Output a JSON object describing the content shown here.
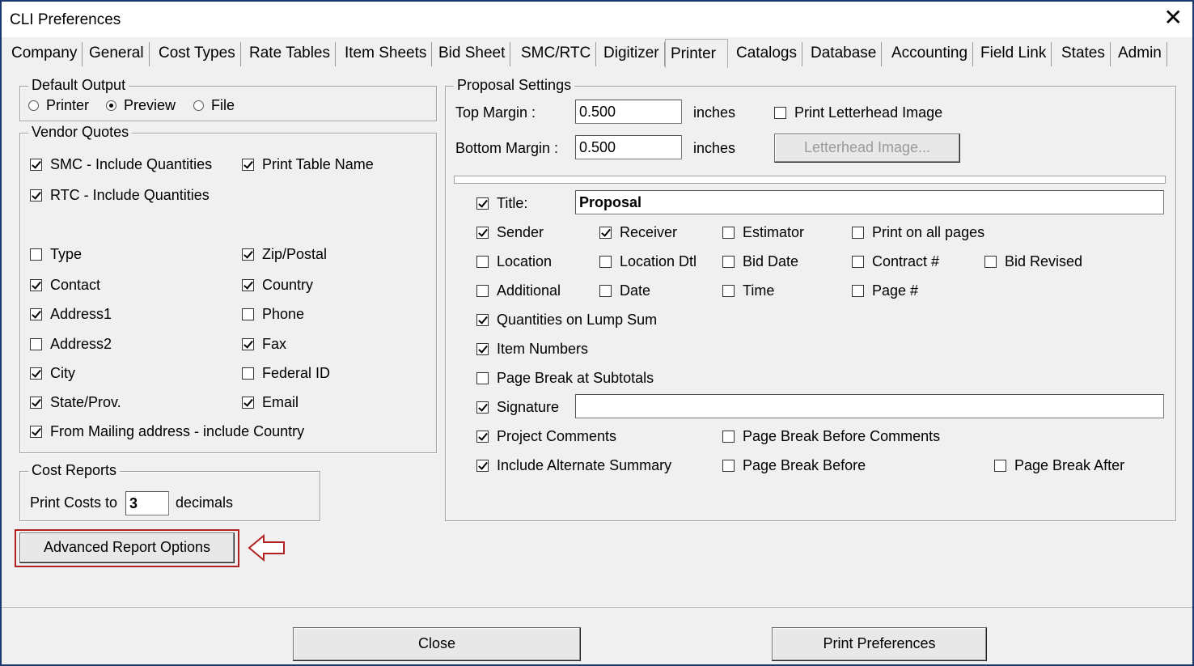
{
  "window": {
    "title": "CLI Preferences",
    "close_glyph": "✕"
  },
  "tabs": [
    {
      "label": "Company"
    },
    {
      "label": "General"
    },
    {
      "label": "Cost Types"
    },
    {
      "label": "Rate Tables"
    },
    {
      "label": "Item Sheets"
    },
    {
      "label": "Bid Sheet"
    },
    {
      "label": "SMC/RTC"
    },
    {
      "label": "Digitizer"
    },
    {
      "label": "Printer"
    },
    {
      "label": "Catalogs"
    },
    {
      "label": "Database"
    },
    {
      "label": "Accounting"
    },
    {
      "label": "Field Link"
    },
    {
      "label": "States"
    },
    {
      "label": "Admin"
    }
  ],
  "active_tab": "Printer",
  "default_output": {
    "legend": "Default Output",
    "options": [
      {
        "label": "Printer",
        "selected": false
      },
      {
        "label": "Preview",
        "selected": true
      },
      {
        "label": "File",
        "selected": false
      }
    ]
  },
  "vendor_quotes": {
    "legend": "Vendor Quotes",
    "smc_include_qty": {
      "label": "SMC - Include Quantities",
      "checked": true
    },
    "print_table_name": {
      "label": "Print Table Name",
      "checked": true
    },
    "rtc_include_qty": {
      "label": "RTC - Include Quantities",
      "checked": true
    },
    "type": {
      "label": "Type",
      "checked": false
    },
    "zip": {
      "label": "Zip/Postal",
      "checked": true
    },
    "contact": {
      "label": "Contact",
      "checked": true
    },
    "country": {
      "label": "Country",
      "checked": true
    },
    "address1": {
      "label": "Address1",
      "checked": true
    },
    "phone": {
      "label": "Phone",
      "checked": false
    },
    "address2": {
      "label": "Address2",
      "checked": false
    },
    "fax": {
      "label": "Fax",
      "checked": true
    },
    "city": {
      "label": "City",
      "checked": true
    },
    "federal_id": {
      "label": "Federal ID",
      "checked": false
    },
    "state": {
      "label": "State/Prov.",
      "checked": true
    },
    "email": {
      "label": "Email",
      "checked": true
    },
    "from_mailing": {
      "label": "From Mailing address - include Country",
      "checked": true
    }
  },
  "cost_reports": {
    "legend": "Cost Reports",
    "prefix": "Print Costs to",
    "decimals_value": "3",
    "suffix": "decimals"
  },
  "advanced_button": {
    "label": "Advanced Report Options"
  },
  "proposal": {
    "legend": "Proposal Settings",
    "top_margin_label": "Top Margin :",
    "top_margin_value": "0.500",
    "bottom_margin_label": "Bottom Margin :",
    "bottom_margin_value": "0.500",
    "unit": "inches",
    "print_letterhead": {
      "label": "Print Letterhead Image",
      "checked": false
    },
    "letterhead_button": "Letterhead Image...",
    "title_cb": {
      "label": "Title:",
      "checked": true
    },
    "title_value": "Proposal",
    "sender": {
      "label": "Sender",
      "checked": true
    },
    "receiver": {
      "label": "Receiver",
      "checked": true
    },
    "estimator": {
      "label": "Estimator",
      "checked": false
    },
    "print_all_pages": {
      "label": "Print on all pages",
      "checked": false
    },
    "location": {
      "label": "Location",
      "checked": false
    },
    "location_dtl": {
      "label": "Location Dtl",
      "checked": false
    },
    "bid_date": {
      "label": "Bid Date",
      "checked": false
    },
    "contract_no": {
      "label": "Contract #",
      "checked": false
    },
    "bid_revised": {
      "label": "Bid Revised",
      "checked": false
    },
    "additional": {
      "label": "Additional",
      "checked": false
    },
    "date": {
      "label": "Date",
      "checked": false
    },
    "time": {
      "label": "Time",
      "checked": false
    },
    "page_no": {
      "label": "Page #",
      "checked": false
    },
    "qty_lump_sum": {
      "label": "Quantities on Lump Sum",
      "checked": true
    },
    "item_numbers": {
      "label": "Item Numbers",
      "checked": true
    },
    "page_break_subtotals": {
      "label": "Page Break at Subtotals",
      "checked": false
    },
    "signature": {
      "label": "Signature",
      "checked": true
    },
    "signature_value": "",
    "project_comments": {
      "label": "Project Comments",
      "checked": true
    },
    "page_break_before_comments": {
      "label": "Page Break Before Comments",
      "checked": false
    },
    "include_alt_summary": {
      "label": "Include Alternate Summary",
      "checked": true
    },
    "page_break_before": {
      "label": "Page Break Before",
      "checked": false
    },
    "page_break_after": {
      "label": "Page Break After",
      "checked": false
    }
  },
  "footer": {
    "close_label": "Close",
    "print_label": "Print Preferences"
  },
  "colors": {
    "highlight": "#b02020",
    "window_border": "#1a3a6e"
  }
}
